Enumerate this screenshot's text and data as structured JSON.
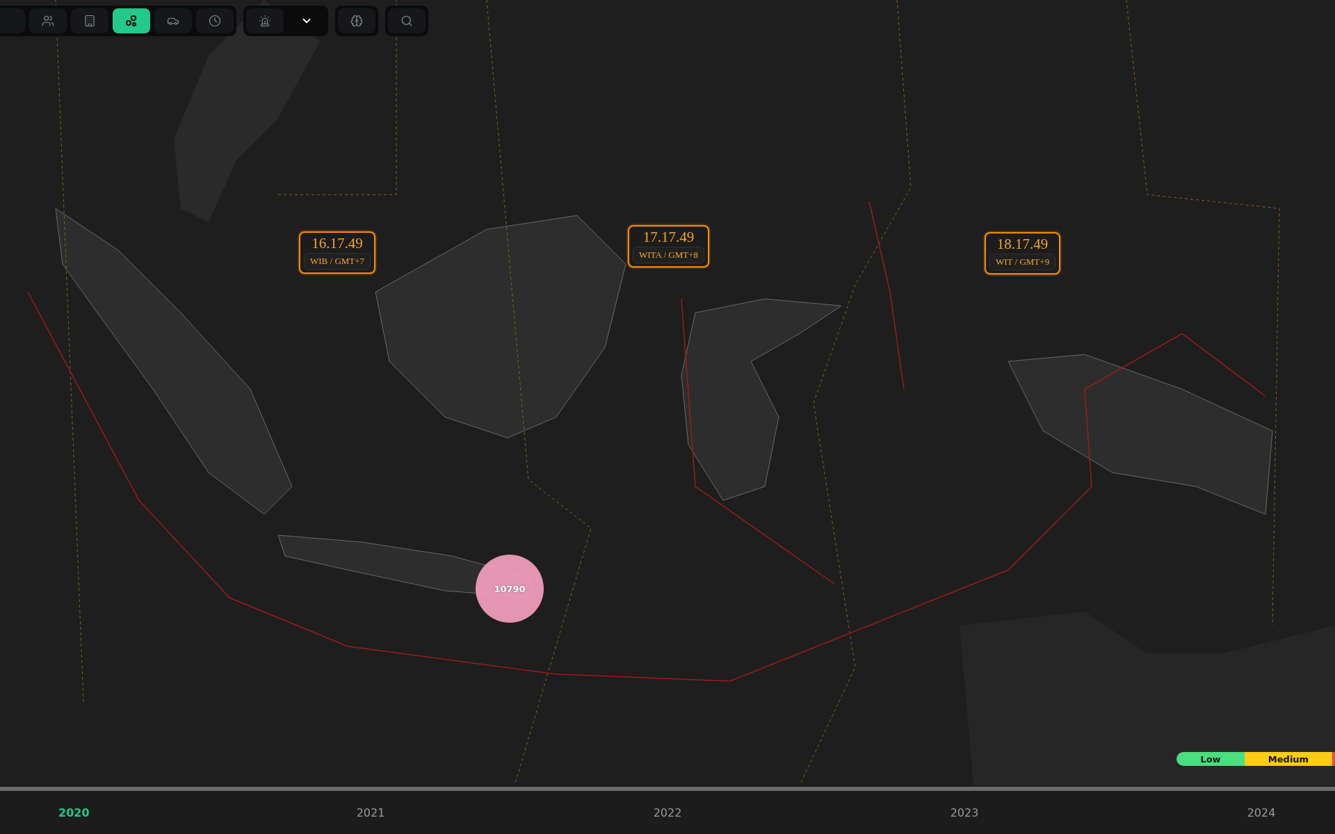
{
  "toolbar": {
    "groups": [
      {
        "buttons": [
          {
            "kind": "users",
            "selected": false
          },
          {
            "kind": "building",
            "selected": false
          },
          {
            "kind": "bubbles",
            "selected": true
          },
          {
            "kind": "car",
            "selected": false
          },
          {
            "kind": "clock",
            "selected": false
          }
        ]
      },
      {
        "buttons": [
          {
            "kind": "siren",
            "selected": false
          },
          {
            "kind": "chevron",
            "selected": false
          }
        ]
      },
      {
        "buttons": [
          {
            "kind": "brain",
            "selected": false
          }
        ]
      },
      {
        "buttons": [
          {
            "kind": "search",
            "selected": false
          }
        ]
      }
    ]
  },
  "time_zones": [
    {
      "time": "16.17.49",
      "zone": "WIB / GMT+7"
    },
    {
      "time": "17.17.49",
      "zone": "WITA / GMT+8"
    },
    {
      "time": "18.17.49",
      "zone": "WIT / GMT+9"
    }
  ],
  "cluster": {
    "count": "10790"
  },
  "legend": [
    {
      "label": "Low",
      "color": "#4ade80"
    },
    {
      "label": "Medium",
      "color": "#facc15"
    },
    {
      "color": "#ef4444"
    }
  ],
  "timeline": {
    "years": [
      {
        "label": "2020",
        "selected": true
      },
      {
        "label": "2021",
        "selected": false
      },
      {
        "label": "2022",
        "selected": false
      },
      {
        "label": "2023",
        "selected": false
      },
      {
        "label": "2024",
        "selected": false
      }
    ]
  }
}
